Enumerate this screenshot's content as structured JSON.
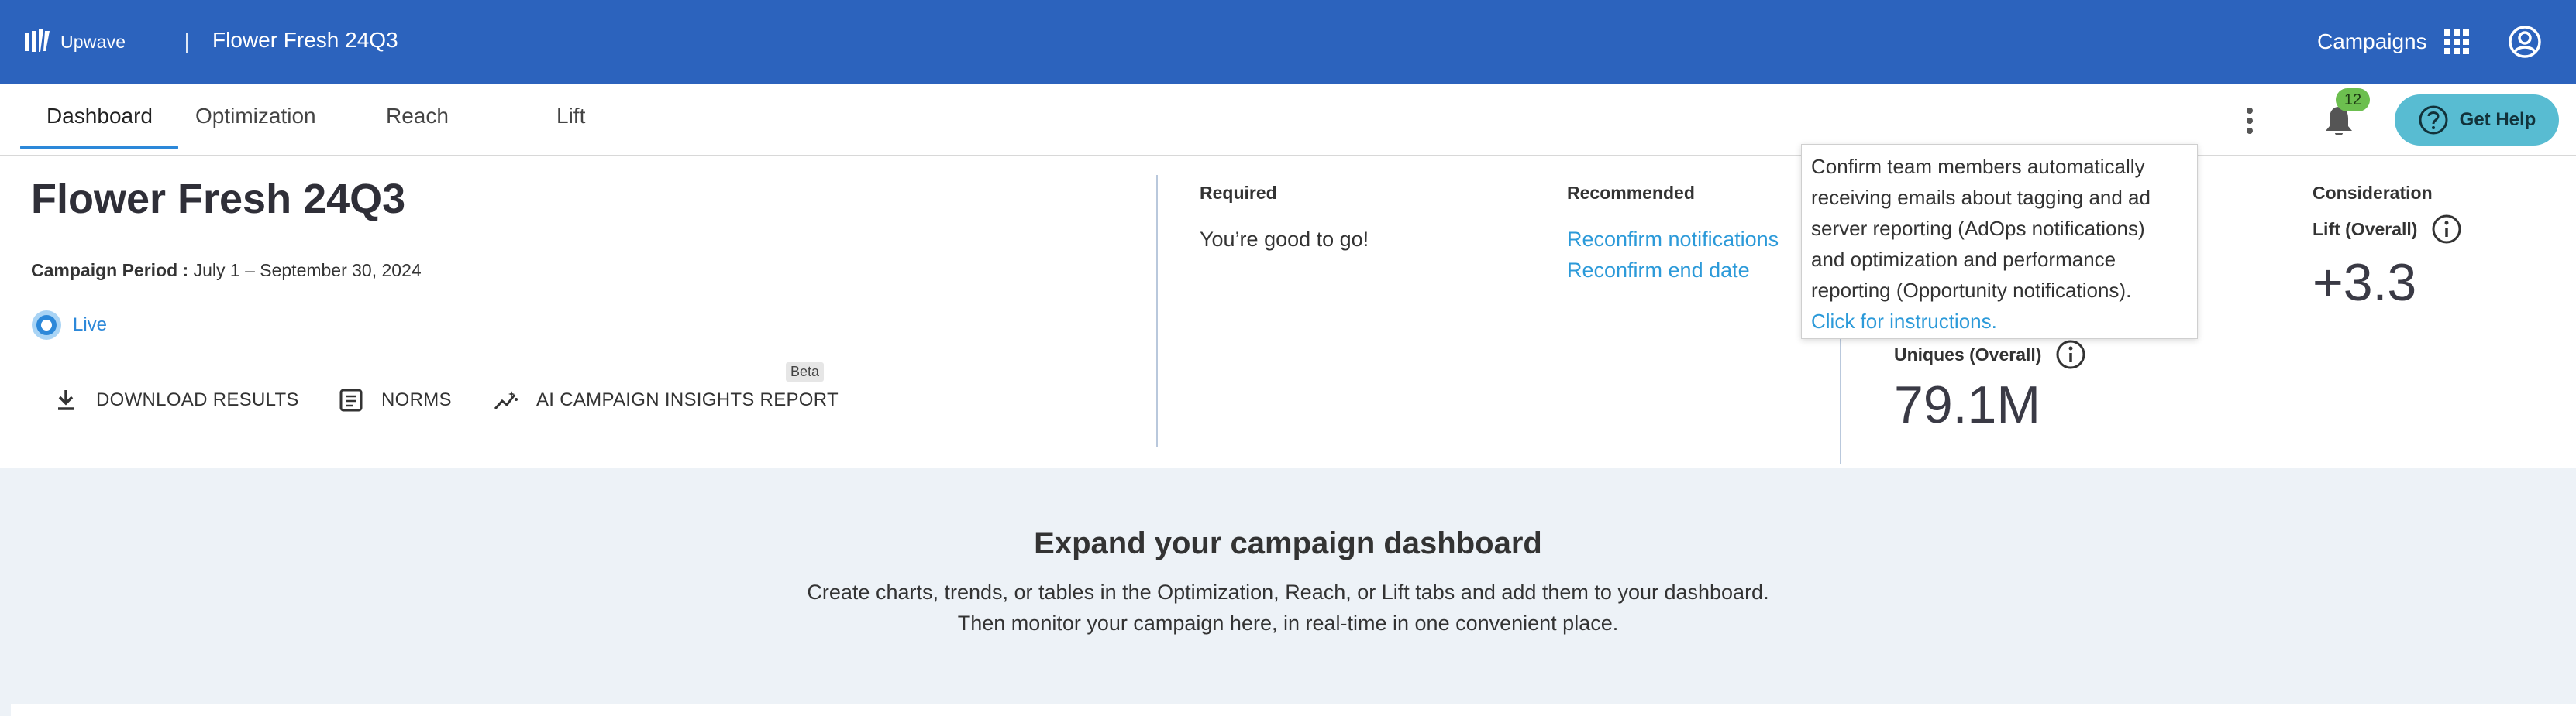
{
  "header": {
    "logo_text": "Upwave",
    "campaign_name": "Flower Fresh 24Q3",
    "campaigns_label": "Campaigns"
  },
  "tabs": [
    {
      "label": "Dashboard",
      "active": true
    },
    {
      "label": "Optimization",
      "active": false
    },
    {
      "label": "Reach",
      "active": false
    },
    {
      "label": "Lift",
      "active": false
    }
  ],
  "notifications": {
    "count": "12"
  },
  "help": {
    "label": "Get Help"
  },
  "summary": {
    "title": "Flower Fresh 24Q3",
    "period_label": "Campaign Period :",
    "period_value": "July 1 – September 30, 2024",
    "status": "Live",
    "actions": {
      "download": "DOWNLOAD RESULTS",
      "norms": "NORMS",
      "ai_report": "AI CAMPAIGN INSIGHTS REPORT",
      "beta": "Beta"
    }
  },
  "required": {
    "heading": "Required",
    "message": "You’re good to go!"
  },
  "recommended": {
    "heading": "Recommended",
    "links": [
      "Reconfirm notifications",
      "Reconfirm end date"
    ]
  },
  "metrics": {
    "uniques_label": "Uniques (Overall)",
    "uniques_value": "79.1M",
    "consideration_heading": "Consideration",
    "lift_label": "Lift (Overall)",
    "lift_value": "+3.3"
  },
  "tooltip": {
    "lines": [
      "Confirm team members automatically",
      "receiving emails about tagging and ad",
      "server reporting (AdOps notifications)",
      "and optimization and performance",
      "reporting (Opportunity notifications)."
    ],
    "link": "Click for instructions."
  },
  "empty_state": {
    "title": "Expand your campaign dashboard",
    "line1": "Create charts, trends, or tables in the Optimization, Reach, or Lift tabs and add them to your dashboard.",
    "line2": "Then monitor your campaign here, in real-time in one convenient place."
  },
  "colors": {
    "header_bg": "#2c63bd",
    "accent": "#2c88d9",
    "link": "#2c9ad9",
    "help_bg": "#58bcd2",
    "badge_bg": "#6cbf4f",
    "lower_bg": "#edf2f7"
  },
  "icons": [
    "upwave-logo-icon",
    "apps-grid-icon",
    "user-circle-icon",
    "kebab-menu-icon",
    "bell-icon",
    "help-question-icon",
    "live-status-icon",
    "download-icon",
    "norms-list-icon",
    "insights-trend-icon",
    "info-icon"
  ]
}
